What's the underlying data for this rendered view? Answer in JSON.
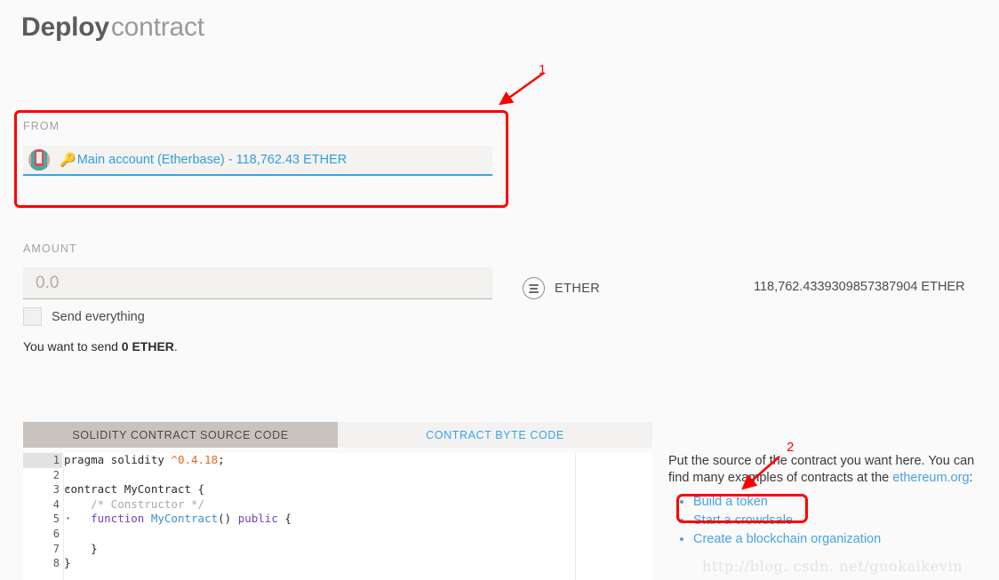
{
  "page": {
    "title_strong": "Deploy",
    "title_light": "contract"
  },
  "from": {
    "label": "FROM",
    "account_icon": "identicon-avatar",
    "key_icon": "key-icon",
    "account_text": "Main account (Etherbase) - 118,762.43 ETHER",
    "accent_color": "#2e9fe0"
  },
  "amount": {
    "label": "AMOUNT",
    "input_value": "",
    "input_placeholder": "0.0",
    "send_everything_label": "Send everything",
    "send_everything_checked": false,
    "summary_prefix": "You want to send ",
    "summary_amount": "0 ETHER",
    "summary_suffix": ".",
    "unit_icon": "ether-unit-icon",
    "unit_name": "ETHER",
    "balance_text": "118,762.4339309857387904 ETHER"
  },
  "editor": {
    "tabs": [
      {
        "label": "Solidity contract source code",
        "active": true
      },
      {
        "label": "Contract byte code",
        "active": false
      }
    ],
    "lines": [
      {
        "num": "1",
        "fold": false,
        "active": true,
        "tokens": [
          {
            "t": "pragma solidity ",
            "c": ""
          },
          {
            "t": "^0.4.18",
            "c": "tok-ver"
          },
          {
            "t": ";",
            "c": ""
          }
        ]
      },
      {
        "num": "2",
        "fold": false,
        "active": false,
        "tokens": [
          {
            "t": "",
            "c": ""
          }
        ]
      },
      {
        "num": "3",
        "fold": true,
        "active": false,
        "tokens": [
          {
            "t": "contract MyContract {",
            "c": ""
          }
        ]
      },
      {
        "num": "4",
        "fold": false,
        "active": false,
        "tokens": [
          {
            "t": "    ",
            "c": ""
          },
          {
            "t": "/* Constructor */",
            "c": "tok-com"
          }
        ]
      },
      {
        "num": "5",
        "fold": true,
        "active": false,
        "tokens": [
          {
            "t": "    ",
            "c": ""
          },
          {
            "t": "function ",
            "c": "tok-kw"
          },
          {
            "t": "MyContract",
            "c": "tok-fn"
          },
          {
            "t": "() ",
            "c": ""
          },
          {
            "t": "public",
            "c": "tok-kw"
          },
          {
            "t": " {",
            "c": ""
          }
        ]
      },
      {
        "num": "6",
        "fold": false,
        "active": false,
        "tokens": [
          {
            "t": "",
            "c": ""
          }
        ]
      },
      {
        "num": "7",
        "fold": false,
        "active": false,
        "tokens": [
          {
            "t": "    }",
            "c": ""
          }
        ]
      },
      {
        "num": "8",
        "fold": false,
        "active": false,
        "tokens": [
          {
            "t": "}",
            "c": ""
          }
        ]
      }
    ],
    "fold_glyph": "▾"
  },
  "help": {
    "paragraph_part1": "Put the source of the contract you want here. You can find many examples of contracts at the ",
    "link_label": "ethereum.org",
    "paragraph_part2": ":",
    "items": [
      {
        "label": "Build a token"
      },
      {
        "label": "Start a crowdsale"
      },
      {
        "label": "Create a blockchain organization"
      }
    ]
  },
  "watermark": {
    "text": "http://blog. csdn. net/guokaikevin"
  },
  "annotations": {
    "marker_1": "1",
    "marker_2": "2",
    "color": "#ff0000"
  }
}
